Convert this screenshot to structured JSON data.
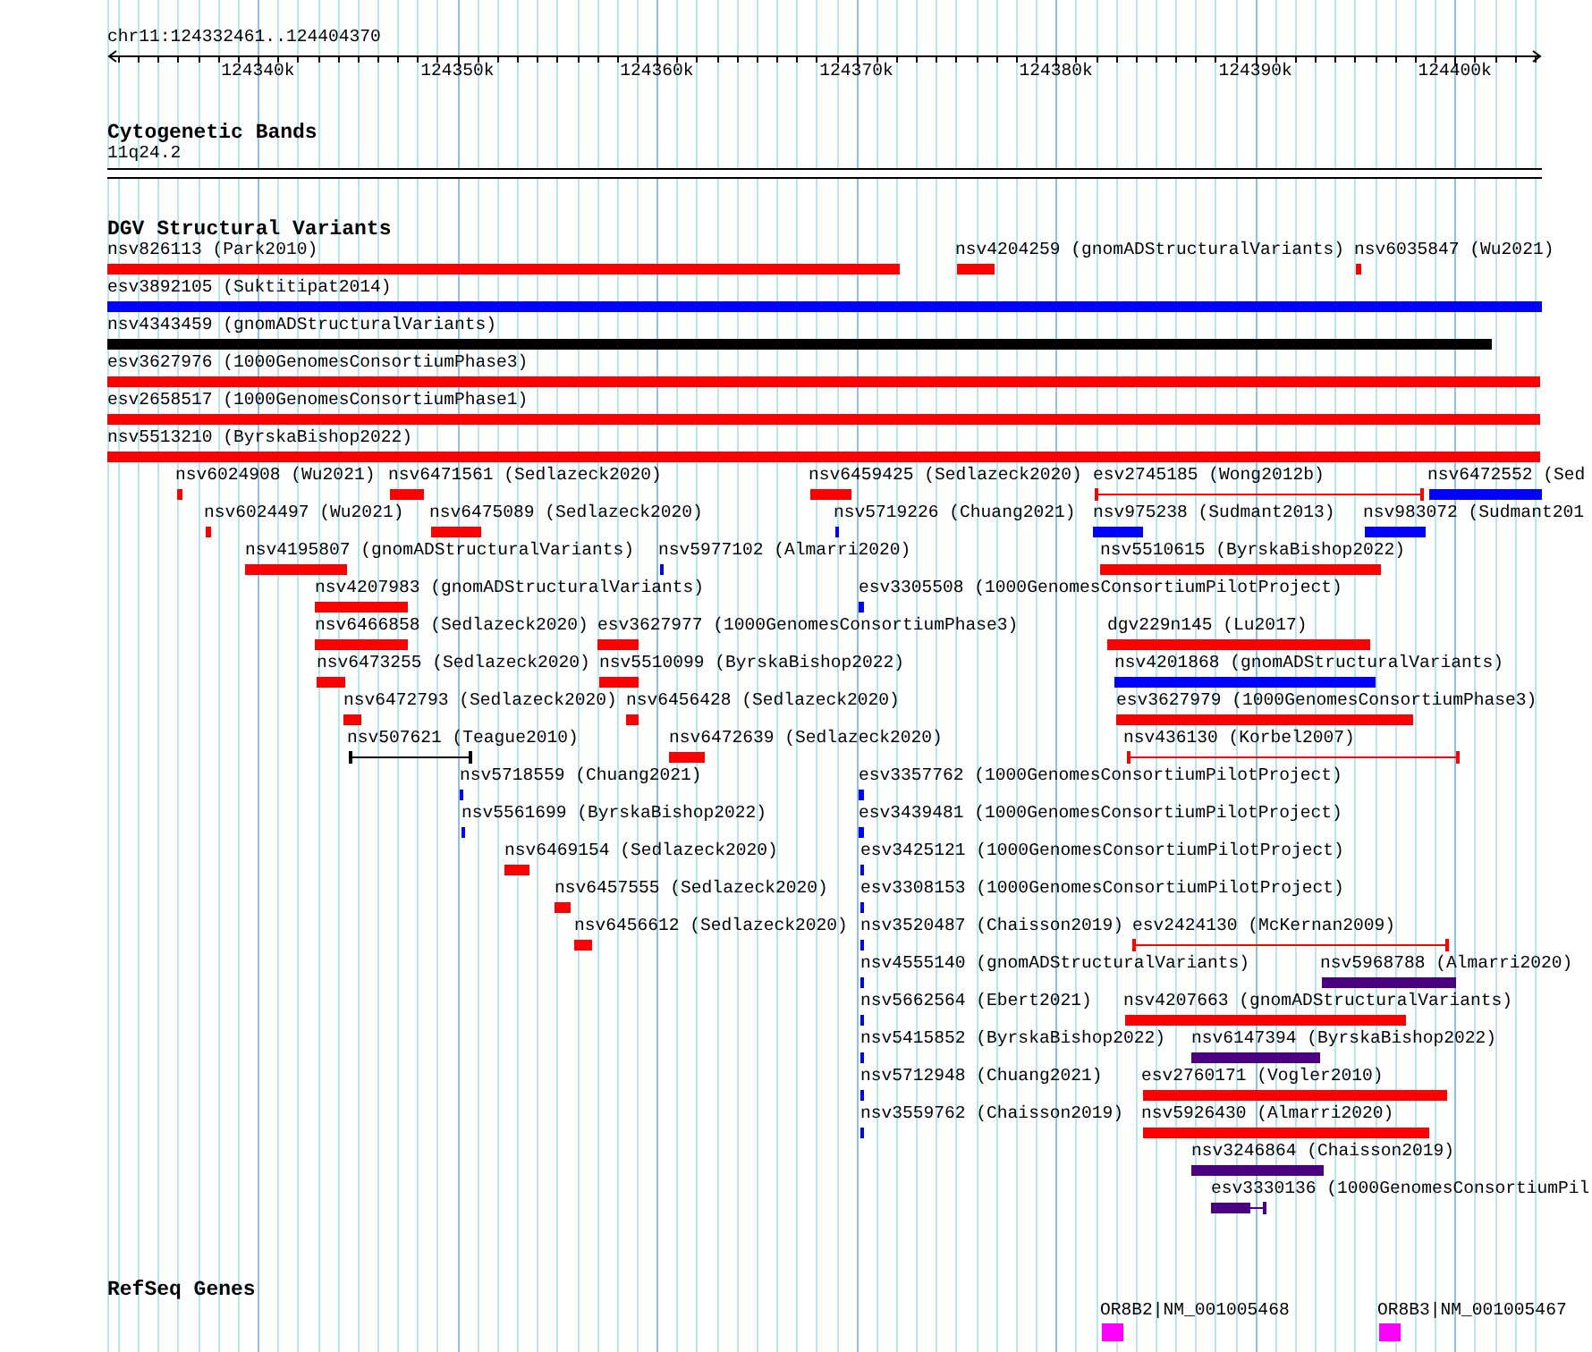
{
  "locus": "chr11:124332461..124404370",
  "ruler": {
    "ticks": [
      "124340k",
      "124350k",
      "124360k",
      "124370k",
      "124380k",
      "124390k",
      "124400k"
    ]
  },
  "tracks": [
    {
      "title": "Cytogenetic Bands",
      "kind": "bands",
      "features": [
        {
          "label": "11q24.2"
        }
      ]
    },
    {
      "title": "DGV Structural Variants",
      "kind": "variants",
      "features": [
        {
          "label": "nsv826113 (Park2010)",
          "color": "#ff0000",
          "kind": "bar"
        },
        {
          "label": "nsv4204259 (gnomADStructuralVariants)",
          "color": "#ff0000",
          "kind": "bar"
        },
        {
          "label": "nsv6035847 (Wu2021)",
          "color": "#ff0000",
          "kind": "bar"
        },
        {
          "label": "esv3892105 (Suktitipat2014)",
          "color": "#0000ff",
          "kind": "bar"
        },
        {
          "label": "nsv4343459 (gnomADStructuralVariants)",
          "color": "#000000",
          "kind": "bar"
        },
        {
          "label": "esv3627976 (1000GenomesConsortiumPhase3)",
          "color": "#ff0000",
          "kind": "bar"
        },
        {
          "label": "esv2658517 (1000GenomesConsortiumPhase1)",
          "color": "#ff0000",
          "kind": "bar"
        },
        {
          "label": "nsv5513210 (ByrskaBishop2022)",
          "color": "#ff0000",
          "kind": "bar"
        },
        {
          "label": "nsv6024908 (Wu2021)",
          "color": "#ff0000",
          "kind": "bar"
        },
        {
          "label": "nsv6471561 (Sedlazeck2020)",
          "color": "#ff0000",
          "kind": "bar"
        },
        {
          "label": "nsv6459425 (Sedlazeck2020)",
          "color": "#ff0000",
          "kind": "bar"
        },
        {
          "label": "esv2745185 (Wong2012b)",
          "color": "#ff0000",
          "kind": "span"
        },
        {
          "label": "nsv6472552 (Sed",
          "color": "#0000ff",
          "kind": "bar"
        },
        {
          "label": "nsv6024497 (Wu2021)",
          "color": "#ff0000",
          "kind": "bar"
        },
        {
          "label": "nsv6475089 (Sedlazeck2020)",
          "color": "#ff0000",
          "kind": "bar"
        },
        {
          "label": "nsv5719226 (Chuang2021)",
          "color": "#0000ff",
          "kind": "bar"
        },
        {
          "label": "nsv975238 (Sudmant2013)",
          "color": "#0000ff",
          "kind": "bar"
        },
        {
          "label": "nsv983072 (Sudmant201",
          "color": "#0000ff",
          "kind": "bar"
        },
        {
          "label": "nsv4195807 (gnomADStructuralVariants)",
          "color": "#ff0000",
          "kind": "bar"
        },
        {
          "label": "nsv5977102 (Almarri2020)",
          "color": "#0000ff",
          "kind": "bar"
        },
        {
          "label": "nsv5510615 (ByrskaBishop2022)",
          "color": "#ff0000",
          "kind": "bar"
        },
        {
          "label": "nsv4207983 (gnomADStructuralVariants)",
          "color": "#ff0000",
          "kind": "bar"
        },
        {
          "label": "esv3305508 (1000GenomesConsortiumPilotProject)",
          "color": "#0000ff",
          "kind": "bar"
        },
        {
          "label": "nsv6466858 (Sedlazeck2020)",
          "color": "#ff0000",
          "kind": "bar"
        },
        {
          "label": "esv3627977 (1000GenomesConsortiumPhase3)",
          "color": "#ff0000",
          "kind": "bar"
        },
        {
          "label": "dgv229n145 (Lu2017)",
          "color": "#ff0000",
          "kind": "bar"
        },
        {
          "label": "nsv6473255 (Sedlazeck2020)",
          "color": "#ff0000",
          "kind": "bar"
        },
        {
          "label": "nsv5510099 (ByrskaBishop2022)",
          "color": "#ff0000",
          "kind": "bar"
        },
        {
          "label": "nsv4201868 (gnomADStructuralVariants)",
          "color": "#0000ff",
          "kind": "bar"
        },
        {
          "label": "nsv6472793 (Sedlazeck2020)",
          "color": "#ff0000",
          "kind": "bar"
        },
        {
          "label": "nsv6456428 (Sedlazeck2020)",
          "color": "#ff0000",
          "kind": "bar"
        },
        {
          "label": "esv3627979 (1000GenomesConsortiumPhase3)",
          "color": "#ff0000",
          "kind": "bar"
        },
        {
          "label": "nsv507621 (Teague2010)",
          "color": "#000000",
          "kind": "span"
        },
        {
          "label": "nsv6472639 (Sedlazeck2020)",
          "color": "#ff0000",
          "kind": "bar"
        },
        {
          "label": "nsv436130 (Korbel2007)",
          "color": "#ff0000",
          "kind": "span"
        },
        {
          "label": "nsv5718559 (Chuang2021)",
          "color": "#0000ff",
          "kind": "bar"
        },
        {
          "label": "esv3357762 (1000GenomesConsortiumPilotProject)",
          "color": "#0000ff",
          "kind": "bar"
        },
        {
          "label": "nsv5561699 (ByrskaBishop2022)",
          "color": "#0000ff",
          "kind": "bar"
        },
        {
          "label": "esv3439481 (1000GenomesConsortiumPilotProject)",
          "color": "#0000ff",
          "kind": "bar"
        },
        {
          "label": "nsv6469154 (Sedlazeck2020)",
          "color": "#ff0000",
          "kind": "bar"
        },
        {
          "label": "esv3425121 (1000GenomesConsortiumPilotProject)",
          "color": "#0000ff",
          "kind": "bar"
        },
        {
          "label": "nsv6457555 (Sedlazeck2020)",
          "color": "#ff0000",
          "kind": "bar"
        },
        {
          "label": "esv3308153 (1000GenomesConsortiumPilotProject)",
          "color": "#0000ff",
          "kind": "bar"
        },
        {
          "label": "nsv6456612 (Sedlazeck2020)",
          "color": "#ff0000",
          "kind": "bar"
        },
        {
          "label": "nsv3520487 (Chaisson2019)",
          "color": "#0000ff",
          "kind": "bar"
        },
        {
          "label": "esv2424130 (McKernan2009)",
          "color": "#ff0000",
          "kind": "span"
        },
        {
          "label": "nsv4555140 (gnomADStructuralVariants)",
          "color": "#0000ff",
          "kind": "bar"
        },
        {
          "label": "nsv5968788 (Almarri2020)",
          "color": "#4b0082",
          "kind": "bar"
        },
        {
          "label": "nsv5662564 (Ebert2021)",
          "color": "#0000ff",
          "kind": "bar"
        },
        {
          "label": "nsv4207663 (gnomADStructuralVariants)",
          "color": "#ff0000",
          "kind": "bar"
        },
        {
          "label": "nsv5415852 (ByrskaBishop2022)",
          "color": "#0000ff",
          "kind": "bar"
        },
        {
          "label": "nsv6147394 (ByrskaBishop2022)",
          "color": "#4b0082",
          "kind": "bar"
        },
        {
          "label": "nsv5712948 (Chuang2021)",
          "color": "#0000ff",
          "kind": "bar"
        },
        {
          "label": "esv2760171 (Vogler2010)",
          "color": "#ff0000",
          "kind": "bar"
        },
        {
          "label": "nsv3559762 (Chaisson2019)",
          "color": "#0000ff",
          "kind": "bar"
        },
        {
          "label": "nsv5926430 (Almarri2020)",
          "color": "#ff0000",
          "kind": "bar"
        },
        {
          "label": "nsv3246864 (Chaisson2019)",
          "color": "#4b0082",
          "kind": "bar"
        },
        {
          "label": "esv3330136 (1000GenomesConsortiumPil",
          "color": "#4b0082",
          "kind": "bar_span"
        }
      ]
    },
    {
      "title": "RefSeq Genes",
      "kind": "genes",
      "features": [
        {
          "label": "OR8B2|NM_001005468",
          "color": "#ff00ff"
        },
        {
          "label": "OR8B3|NM_001005467",
          "color": "#ff00ff"
        }
      ]
    }
  ]
}
